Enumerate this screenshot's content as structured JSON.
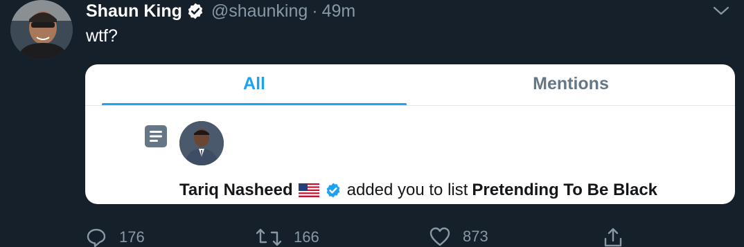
{
  "tweet": {
    "author_name": "Shaun King",
    "handle": "@shaunking",
    "separator": "·",
    "time": "49m",
    "text": "wtf?",
    "avatar_icon": "profile-photo",
    "caret_icon": "chevron-down-icon"
  },
  "card": {
    "tabs": [
      {
        "label": "All",
        "active": true
      },
      {
        "label": "Mentions",
        "active": false
      }
    ],
    "notification": {
      "icon": "list-icon",
      "actor": "Tariq Nasheed",
      "flag": "us-flag",
      "action_text": "added you to list",
      "list_name": "Pretending To Be Black"
    }
  },
  "actions": {
    "reply_count": "176",
    "retweet_count": "166",
    "like_count": "873"
  },
  "colors": {
    "background": "#15202b",
    "accent": "#1da1f2",
    "muted": "#8899a6"
  }
}
